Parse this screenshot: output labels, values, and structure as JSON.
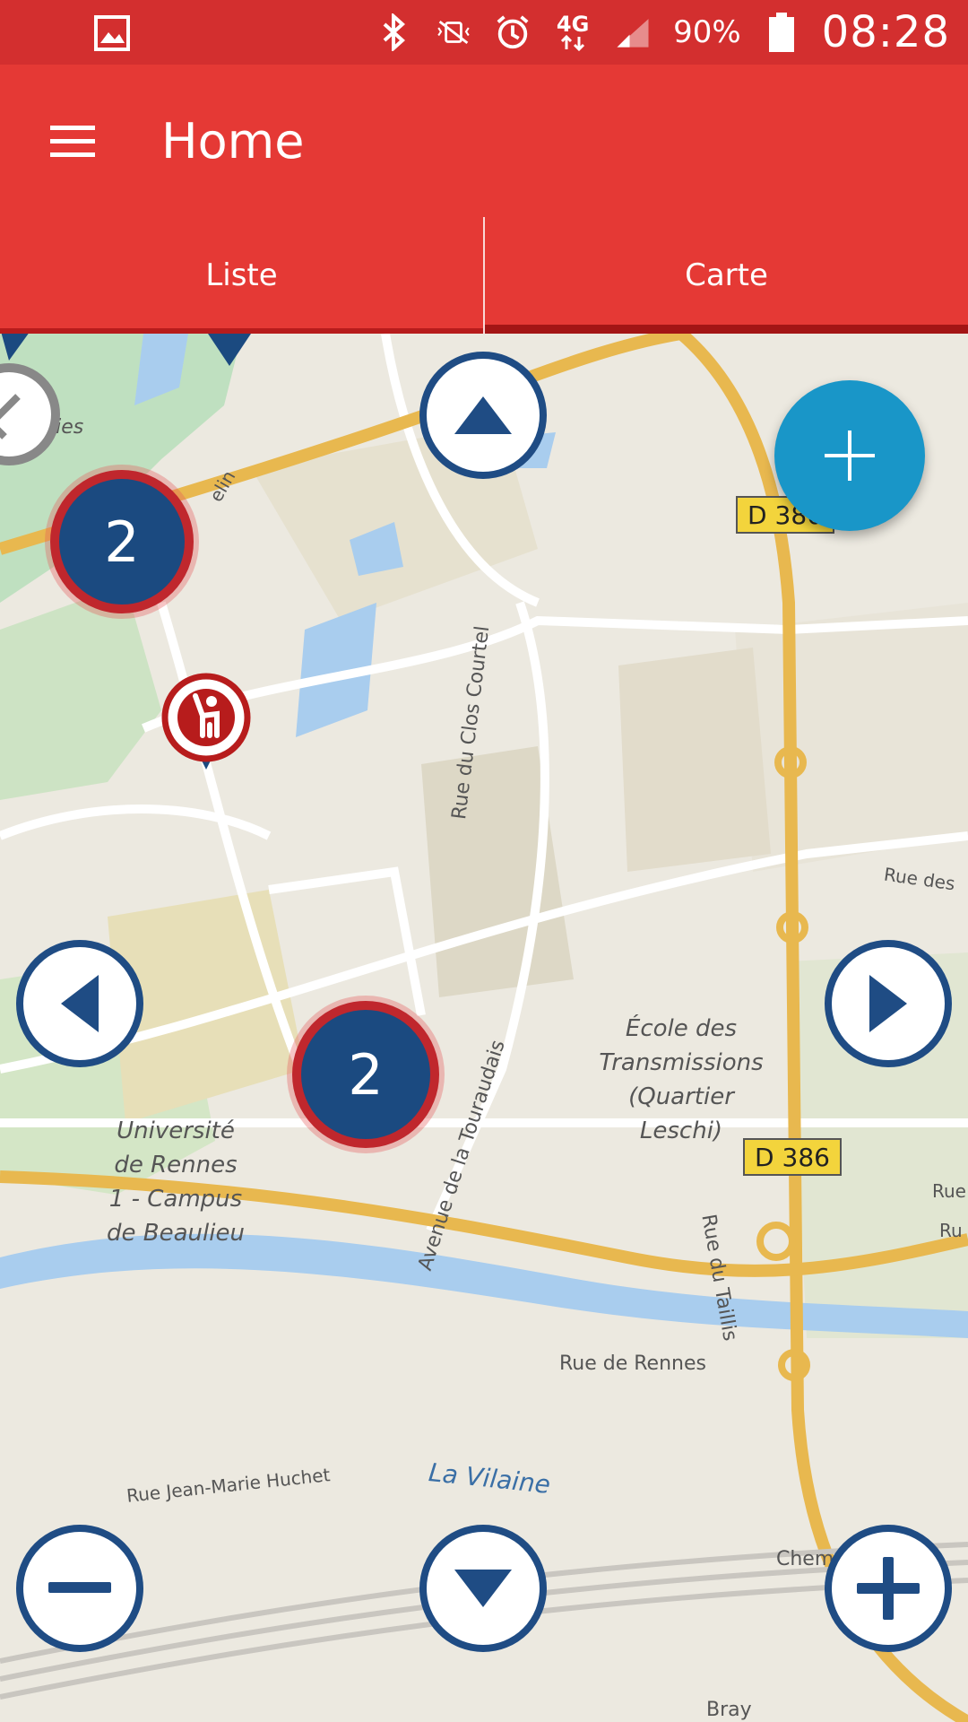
{
  "status_bar": {
    "battery": "90%",
    "time": "08:28",
    "network": "4G"
  },
  "app_bar": {
    "title": "Home"
  },
  "tabs": [
    {
      "label": "Liste",
      "active": false
    },
    {
      "label": "Carte",
      "active": true
    }
  ],
  "map": {
    "clusters": [
      {
        "count": "2"
      },
      {
        "count": "2"
      }
    ],
    "labels": {
      "ecole": [
        "École des",
        "Transmissions",
        "(Quartier",
        "Leschi)"
      ],
      "universite": [
        "Université",
        "de Rennes",
        "1 - Campus",
        "de Beaulieu"
      ],
      "clos_courtel": "Rue du Clos Courtel",
      "touraudais": "Avenue de la Touraudais",
      "taillis": "Rue du Taillis",
      "rennes": "Rue de Rennes",
      "vilaine": "La Vilaine",
      "jean_marie": "Rue Jean-Marie Huchet",
      "d386_top": "D 386",
      "d386_bottom": "D 386",
      "rue_des": "Rue des",
      "elin": "elin",
      "lies": "lies",
      "ru1": "Rue",
      "ru2": "Ru",
      "che": "Chem",
      "bray": "Bray"
    }
  },
  "colors": {
    "status_bar": "#d32f2f",
    "app_bar": "#e53935",
    "tab_indicator": "#a31515",
    "control_border": "#1f4c84",
    "fab": "#1996c8",
    "cluster_fill": "#1b4a80",
    "cluster_ring": "#c0272d"
  }
}
